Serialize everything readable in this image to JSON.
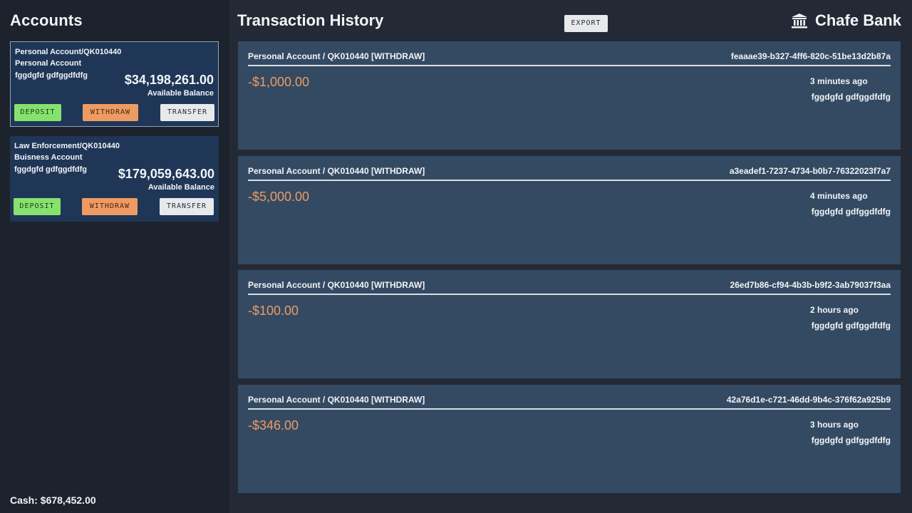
{
  "sidebar": {
    "title": "Accounts",
    "accounts": [
      {
        "id_line": "Personal Account/QK010440",
        "type": "Personal Account",
        "owner": "fggdgfd gdfggdfdfg",
        "balance": "$34,198,261.00",
        "balance_label": "Available Balance",
        "deposit_label": "DEPOSIT",
        "withdraw_label": "WITHDRAW",
        "transfer_label": "TRANSFER",
        "selected": true
      },
      {
        "id_line": "Law Enforcement/QK010440",
        "type": "Buisness Account",
        "owner": "fggdgfd gdfggdfdfg",
        "balance": "$179,059,643.00",
        "balance_label": "Available Balance",
        "deposit_label": "DEPOSIT",
        "withdraw_label": "WITHDRAW",
        "transfer_label": "TRANSFER",
        "selected": false
      }
    ],
    "cash": "Cash: $678,452.00"
  },
  "main": {
    "title": "Transaction History",
    "export_label": "EXPORT",
    "bank_name": "Chafe Bank",
    "bank_icon": "bank-building-icon"
  },
  "transactions": [
    {
      "heading": "Personal Account / QK010440 [WITHDRAW]",
      "tx_id": "feaaae39-b327-4ff6-820c-51be13d2b87a",
      "amount": "-$1,000.00",
      "time": "3 minutes ago",
      "user": "fggdgfd gdfggdfdfg"
    },
    {
      "heading": "Personal Account / QK010440 [WITHDRAW]",
      "tx_id": "a3eadef1-7237-4734-b0b7-76322023f7a7",
      "amount": "-$5,000.00",
      "time": "4 minutes ago",
      "user": "fggdgfd gdfggdfdfg"
    },
    {
      "heading": "Personal Account / QK010440 [WITHDRAW]",
      "tx_id": "26ed7b86-cf94-4b3b-b9f2-3ab79037f3aa",
      "amount": "-$100.00",
      "time": "2 hours ago",
      "user": "fggdgfd gdfggdfdfg"
    },
    {
      "heading": "Personal Account / QK010440 [WITHDRAW]",
      "tx_id": "42a76d1e-c721-46dd-9b4c-376f62a925b9",
      "amount": "-$346.00",
      "time": "3 hours ago",
      "user": "fggdgfd gdfggdfdfg"
    }
  ],
  "colors": {
    "accent_negative": "#ee9b63",
    "deposit": "#86e26d",
    "withdraw": "#ee9b63",
    "transfer": "#e7e9ec"
  }
}
